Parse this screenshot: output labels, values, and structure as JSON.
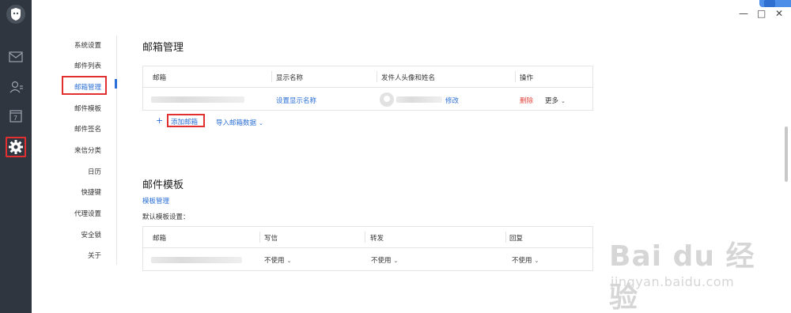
{
  "rail": {
    "icons": [
      "logo-icon",
      "mail-icon",
      "contacts-icon",
      "calendar-icon",
      "settings-icon"
    ],
    "calendar_day": "7"
  },
  "window": {
    "minimize": "—",
    "maximize": "□",
    "close": "✕"
  },
  "settings_nav": {
    "items": [
      {
        "label": "系统设置"
      },
      {
        "label": "邮件列表"
      },
      {
        "label": "邮箱管理",
        "active": true
      },
      {
        "label": "邮件模板"
      },
      {
        "label": "邮件签名"
      },
      {
        "label": "来信分类"
      },
      {
        "label": "日历"
      },
      {
        "label": "快捷键"
      },
      {
        "label": "代理设置"
      },
      {
        "label": "安全锁"
      },
      {
        "label": "关于"
      }
    ]
  },
  "mailbox_section": {
    "title": "邮箱管理",
    "columns": [
      "邮箱",
      "显示名称",
      "发件人头像和姓名",
      "操作"
    ],
    "row": {
      "display_name_link": "设置显示名称",
      "edit_link": "修改",
      "delete": "删除",
      "more": "更多"
    },
    "add_plus": "+",
    "add_mailbox": "添加邮箱",
    "import": "导入邮箱数据"
  },
  "template_section": {
    "title": "邮件模板",
    "manage_link": "模板管理",
    "default_label": "默认模板设置：",
    "columns": [
      "邮箱",
      "写信",
      "转发",
      "回复"
    ],
    "row": {
      "write": "不使用",
      "forward": "不使用",
      "reply": "不使用"
    }
  },
  "watermark": {
    "big": "Bai du 经验",
    "small": "jingyan.baidu.com"
  },
  "colors": {
    "rail": "#2f3640",
    "accent": "#2b6fd6",
    "highlight": "#e23030",
    "delete": "#e0433b"
  }
}
